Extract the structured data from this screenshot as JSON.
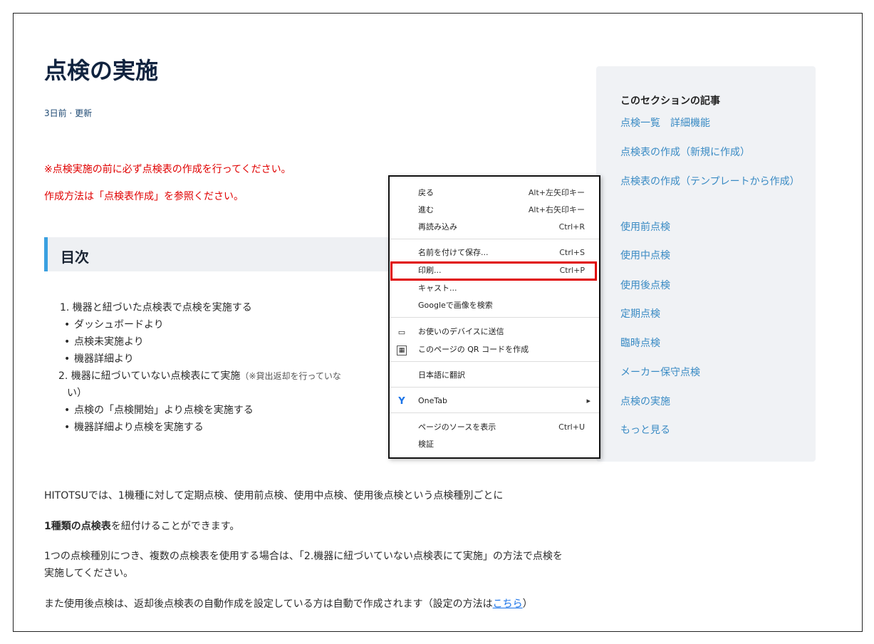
{
  "article": {
    "title": "点検の実施",
    "meta": "3日前 · 更新",
    "warning1": "※点検実施の前に必ず点検表の作成を行ってください。",
    "warning2": "作成方法は「点検表作成」を参照ください。",
    "toc_title": "目次",
    "toc": {
      "item1": "1. 機器と紐づいた点検表で点検を実施する",
      "item1_sub": [
        "ダッシュボードより",
        "点検未実施より",
        "機器詳細より"
      ],
      "item2": "2. 機器に紐づいていない点検表にて実施",
      "item2_note": "（※貸出返却を行っていな",
      "item2_tail": "い）",
      "item2_sub": [
        "点検の「点検開始」より点検を実施する",
        "機器詳細より点検を実施する"
      ]
    },
    "para1": "HITOTSUでは、1機種に対して定期点検、使用前点検、使用中点検、使用後点検という点検種別ごとに",
    "para2_bold": "1種類の点検表",
    "para2_rest": "を紐付けることができます。",
    "para3": "1つの点検種別につき、複数の点検表を使用する場合は、「2.機器に紐づいていない点検表にて実施」の方法で点検を実施してください。",
    "para4": "また使用後点検は、返却後点検表の自動作成を設定している方は自動で作成されます（設定の方法は",
    "para4_link": "こちら",
    "para4_end": "）"
  },
  "sidebar": {
    "title": "このセクションの記事",
    "items": [
      "点検一覧　詳細機能",
      "点検表の作成（新規に作成）",
      "点検表の作成（テンプレートから作成）",
      "使用前点検",
      "使用中点検",
      "使用後点検",
      "定期点検",
      "臨時点検",
      "メーカー保守点検",
      "点検の実施",
      "もっと見る"
    ]
  },
  "context_menu": {
    "items": [
      {
        "label": "戻る",
        "shortcut": "Alt+左矢印キー"
      },
      {
        "label": "進む",
        "shortcut": "Alt+右矢印キー"
      },
      {
        "label": "再読み込み",
        "shortcut": "Ctrl+R"
      },
      {
        "label": "名前を付けて保存...",
        "shortcut": "Ctrl+S"
      },
      {
        "label": "印刷...",
        "shortcut": "Ctrl+P"
      },
      {
        "label": "キャスト...",
        "shortcut": ""
      },
      {
        "label": "Googleで画像を検索",
        "shortcut": ""
      },
      {
        "label": "お使いのデバイスに送信",
        "shortcut": ""
      },
      {
        "label": "このページの QR コードを作成",
        "shortcut": ""
      },
      {
        "label": "日本語に翻訳",
        "shortcut": ""
      },
      {
        "label": "OneTab",
        "shortcut": ""
      },
      {
        "label": "ページのソースを表示",
        "shortcut": "Ctrl+U"
      },
      {
        "label": "検証",
        "shortcut": ""
      }
    ],
    "icons": [
      "device-icon",
      "qr-code-icon",
      "onetab-icon",
      "submenu-arrow-icon"
    ]
  },
  "colors": {
    "warning": "#e00000",
    "link": "#3a8bc4",
    "highlight": "#e00000",
    "toc_accent": "#3aa0e0"
  }
}
